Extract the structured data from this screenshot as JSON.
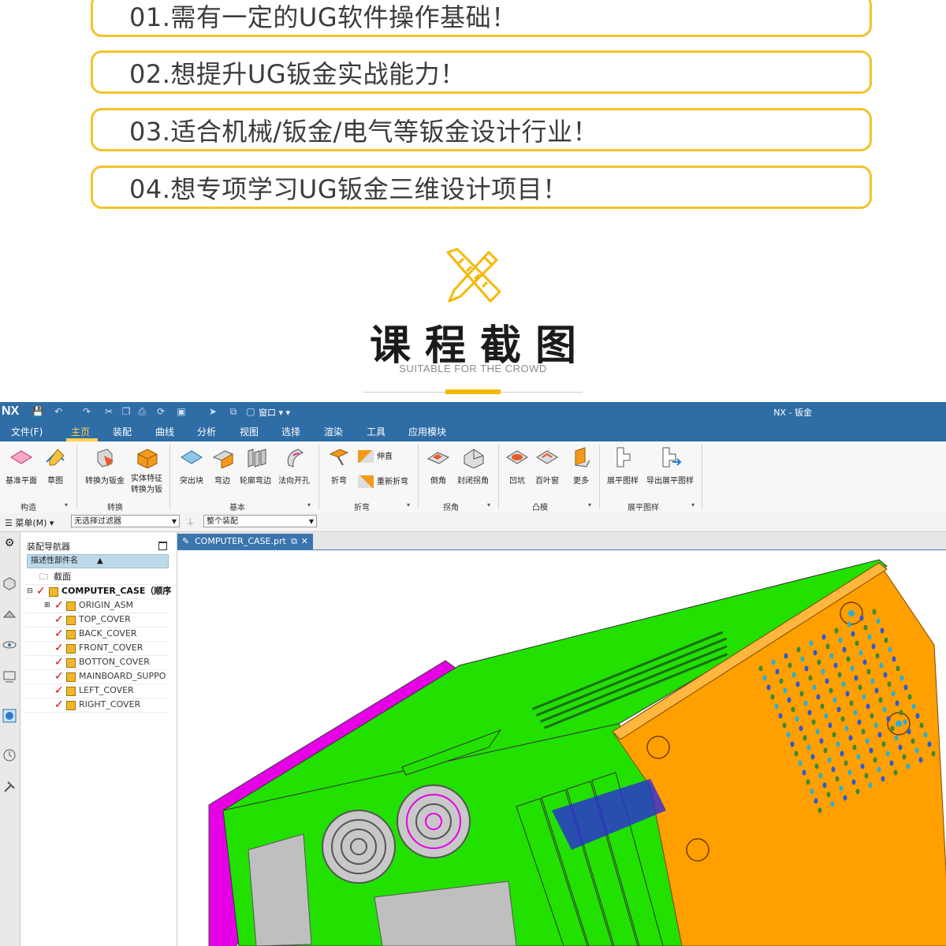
{
  "promo": {
    "items": [
      "01.需有一定的UG软件操作基础！",
      "02.想提升UG钣金实战能力！",
      "03.适合机械/钣金/电气等钣金设计行业！",
      "04.想专项学习UG钣金三维设计项目！"
    ]
  },
  "section": {
    "title": "课程截图",
    "subtitle": "SUITABLE FOR THE CROWD"
  },
  "nx": {
    "logo": "NX",
    "window_title": "NX - 钣金",
    "quick_access_window": "窗口",
    "menu_tabs": [
      "文件(F)",
      "主页",
      "装配",
      "曲线",
      "分析",
      "视图",
      "选择",
      "渲染",
      "工具",
      "应用模块"
    ],
    "ribbon": {
      "buttons": [
        "基准平面",
        "草图",
        "转换为钣金",
        "实体特征转换为钣",
        "突出块",
        "弯边",
        "轮廓弯边",
        "法向开孔",
        "折弯",
        "伸直",
        "重新折弯",
        "倒角",
        "封闭拐角",
        "凹坑",
        "百叶窗",
        "更多",
        "展平图样",
        "导出展平图样"
      ],
      "groups": [
        "构造",
        "转换",
        "基本",
        "折弯",
        "拐角",
        "凸模",
        "展平图样"
      ]
    },
    "filterbar": {
      "menu": "菜单(M)",
      "filter": "无选择过滤器",
      "scope": "整个装配"
    },
    "navigator": {
      "title": "装配导航器",
      "column": "描述性部件名",
      "section_node": "截面",
      "root": "COMPUTER_CASE（顺序",
      "parts": [
        "ORIGIN_ASM",
        "TOP_COVER",
        "BACK_COVER",
        "FRONT_COVER",
        "BOTTON_COVER",
        "MAINBOARD_SUPPO",
        "LEFT_COVER",
        "RIGHT_COVER"
      ]
    },
    "document_tab": "COMPUTER_CASE.prt",
    "colors": {
      "titlebar": "#2f6da6",
      "active_tab": "#ffd34d",
      "case_green": "#22e000",
      "case_orange": "#ff9f00",
      "case_magenta": "#e600e6",
      "promo_border": "#f2c32c"
    }
  }
}
